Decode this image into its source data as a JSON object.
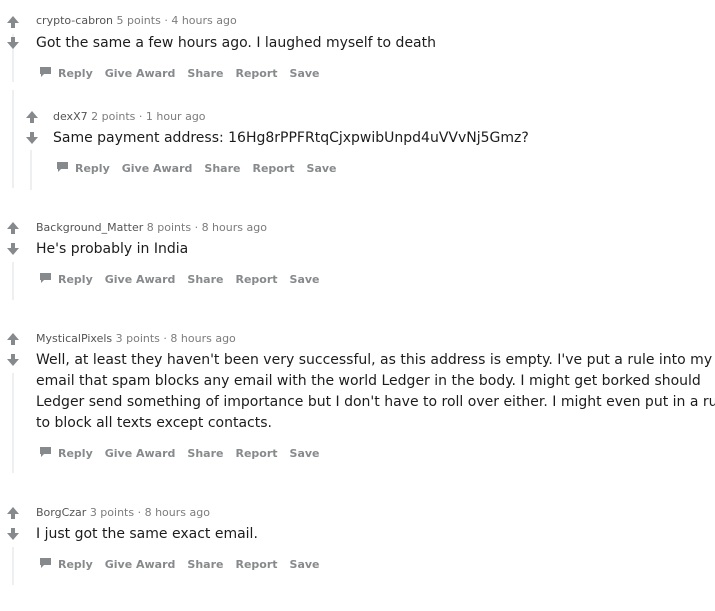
{
  "comments": [
    {
      "author": "crypto-cabron",
      "points": "5 points",
      "time": "4 hours ago",
      "body": "Got the same a few hours ago. I laughed myself to death"
    },
    {
      "author": "dexX7",
      "points": "2 points",
      "time": "1 hour ago",
      "body": "Same payment address: 16Hg8rPPFRtqCjxpwibUnpd4uVVvNj5Gmz?"
    },
    {
      "author": "Background_Matter",
      "points": "8 points",
      "time": "8 hours ago",
      "body": "He's probably in India"
    },
    {
      "author": "MysticalPixels",
      "points": "3 points",
      "time": "8 hours ago",
      "body_lines": [
        "Well, at least they haven't been very successful, as this address is empty. I've put a rule into my",
        "email that spam blocks any email with the world Ledger in the body. I might get borked should",
        "Ledger send something of importance but I don't have to roll over either. I might even put in a rule",
        "to block all texts except contacts."
      ]
    },
    {
      "author": "BorgCzar",
      "points": "3 points",
      "time": "8 hours ago",
      "body": "I just got the same exact email."
    }
  ],
  "actions": {
    "reply": "Reply",
    "give_award": "Give Award",
    "share": "Share",
    "report": "Report",
    "save": "Save"
  },
  "meta_separator": "·",
  "colors": {
    "meta": "#7c7c7c",
    "action": "#878a8c",
    "body": "#1c1c1c",
    "vote_arrow": "#878a8c",
    "thread_line": "#edeff1"
  }
}
